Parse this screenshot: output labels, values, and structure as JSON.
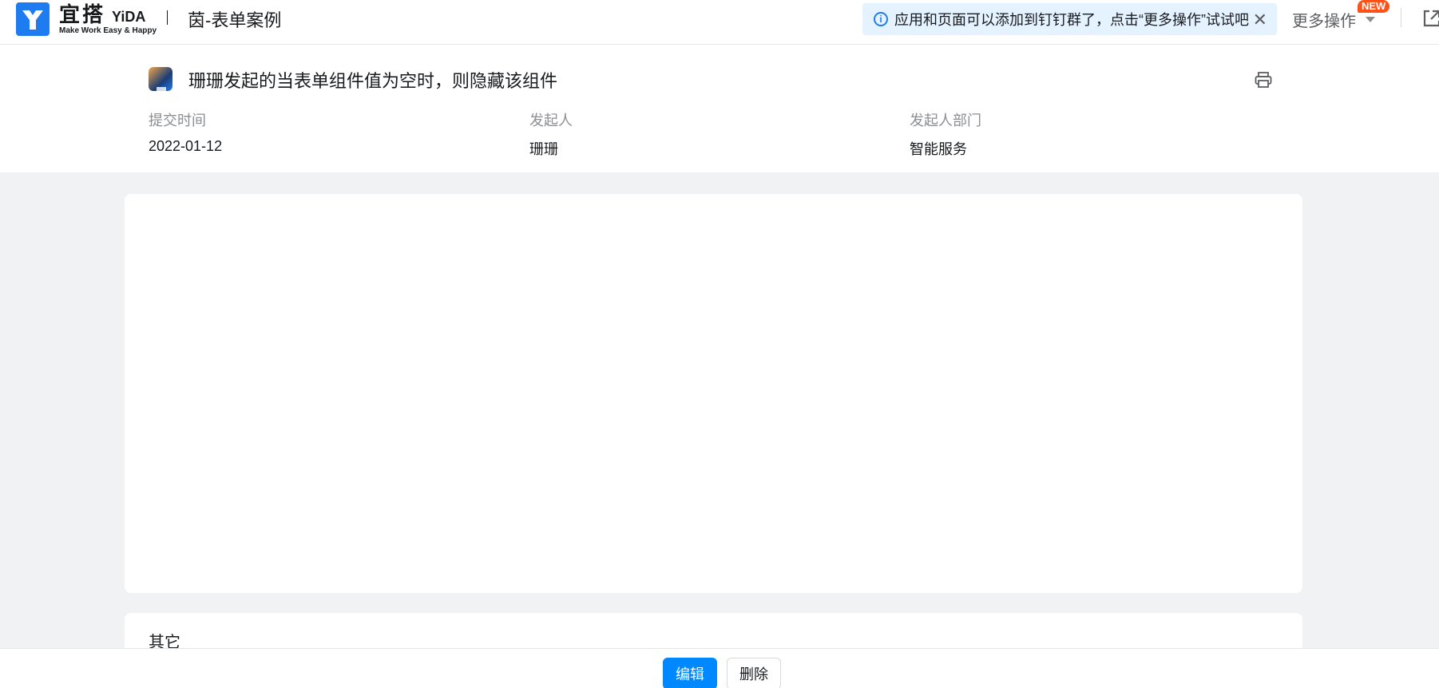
{
  "header": {
    "logo_cn": "宜搭",
    "logo_en": "YiDA",
    "logo_slogan": "Make Work Easy & Happy",
    "app_title": "茵-表单案例",
    "tip_text": "应用和页面可以添加到钉钉群了，点击“更多操作”试试吧",
    "tip_close": "✕",
    "more_ops": "更多操作",
    "new_badge": "NEW"
  },
  "record": {
    "title": "珊珊发起的当表单组件值为空时，则隐藏该组件",
    "meta": [
      {
        "label": "提交时间",
        "value": "2022-01-12"
      },
      {
        "label": "发起人",
        "value": "珊珊"
      },
      {
        "label": "发起人部门",
        "value": "智能服务"
      }
    ]
  },
  "sections": {
    "other_title": "其它"
  },
  "footer": {
    "edit_label": "编辑",
    "delete_label": "删除"
  },
  "colors": {
    "primary": "#0089ff",
    "logo_blue": "#1f7cf0",
    "badge": "#ff5219",
    "tip_bg": "#e5f2ff"
  }
}
